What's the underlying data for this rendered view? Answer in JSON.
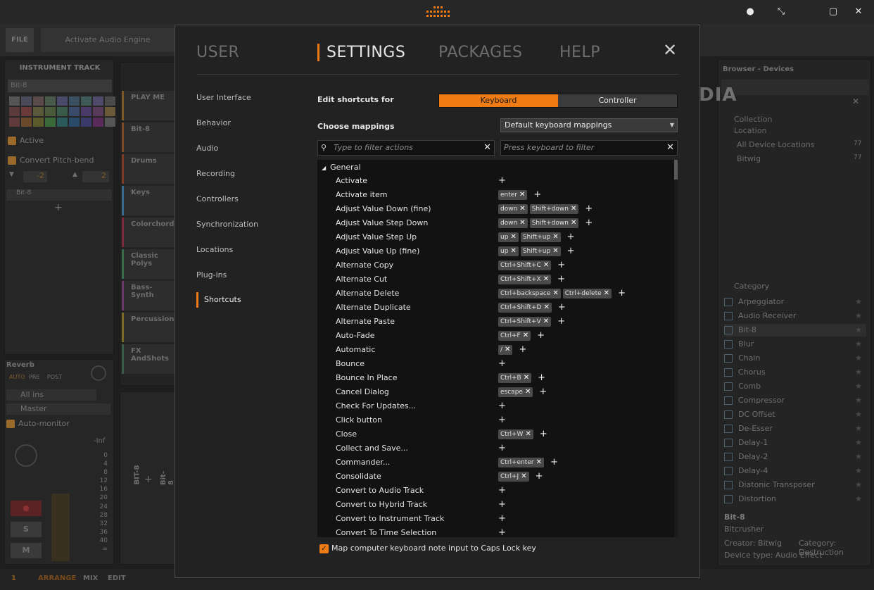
{
  "window": {
    "dot": "●",
    "restore": "⤡",
    "maximize": "▢",
    "close": "✕"
  },
  "toolbar": {
    "file_label": "FILE",
    "activate_label": "Activate Audio Engine"
  },
  "left_panel": {
    "title": "INSTRUMENT TRACK",
    "name_value": "Bit-8",
    "active_label": "Active",
    "pitchbend_label": "Convert Pitch-bend",
    "pb_down": "-2",
    "pb_up": "2",
    "device_label": "Bit-8",
    "add": "+"
  },
  "tracks": [
    "PLAY ME",
    "Bit-8",
    "Drums",
    "Keys",
    "Colorchord",
    "Classic Polys",
    "Bass-Synth",
    "Percussion",
    "FX AndShots"
  ],
  "mixer": {
    "send_label": "Reverb",
    "auto": "AUTO",
    "pre": "PRE",
    "post": "POST",
    "input": "All ins",
    "output": "Master",
    "monitor_label": "Auto-monitor",
    "level": "-Inf",
    "solo": "S",
    "mute": "M",
    "scale": [
      "0",
      "4",
      "8",
      "12",
      "16",
      "20",
      "24",
      "28",
      "32",
      "36",
      "40",
      "∞"
    ],
    "track_name": "BIT-8",
    "track_name2": "Bit-8"
  },
  "bottom": {
    "indicator": "1",
    "arrange": "ARRANGE",
    "mix": "MIX",
    "edit": "EDIT"
  },
  "browser": {
    "title": "Browser - Devices",
    "collection": "Collection",
    "location": "Location",
    "all_locations": "All Device Locations",
    "all_count": "77",
    "bitwig": "Bitwig",
    "bitwig_count": "77",
    "category_title": "Category",
    "categories": [
      "Arpeggiator",
      "Audio Receiver",
      "Bit-8",
      "Blur",
      "Chain",
      "Chorus",
      "Comb",
      "Compressor",
      "DC Offset",
      "De-Esser",
      "Delay-1",
      "Delay-2",
      "Delay-4",
      "Diatonic Transposer",
      "Distortion"
    ],
    "detail_name": "Bit-8",
    "detail_desc": "Bitcrusher",
    "detail_creator": "Creator: Bitwig",
    "detail_category": "Category: Destruction",
    "detail_type": "Device type: Audio Effect"
  },
  "watermark": "SOFTPEDIA",
  "dialog": {
    "tabs": {
      "user": "USER",
      "settings": "SETTINGS",
      "packages": "PACKAGES",
      "help": "HELP"
    },
    "close": "✕",
    "nav": [
      "User Interface",
      "Behavior",
      "Audio",
      "Recording",
      "Controllers",
      "Synchronization",
      "Locations",
      "Plug-ins",
      "Shortcuts"
    ],
    "edit_label": "Edit shortcuts for",
    "keyboard": "Keyboard",
    "controller": "Controller",
    "mappings_label": "Choose mappings",
    "mappings_value": "Default keyboard mappings",
    "filter_actions_placeholder": "Type to filter actions",
    "filter_keys_placeholder": "Press keyboard to filter",
    "group": "General",
    "shortcuts": [
      {
        "name": "Activate",
        "keys": []
      },
      {
        "name": "Activate item",
        "keys": [
          "enter"
        ]
      },
      {
        "name": "Adjust Value Down (fine)",
        "keys": [
          "down",
          "Shift+down"
        ]
      },
      {
        "name": "Adjust Value Step Down",
        "keys": [
          "down",
          "Shift+down"
        ]
      },
      {
        "name": "Adjust Value Step Up",
        "keys": [
          "up",
          "Shift+up"
        ]
      },
      {
        "name": "Adjust Value Up (fine)",
        "keys": [
          "up",
          "Shift+up"
        ]
      },
      {
        "name": "Alternate Copy",
        "keys": [
          "Ctrl+Shift+C"
        ]
      },
      {
        "name": "Alternate Cut",
        "keys": [
          "Ctrl+Shift+X"
        ]
      },
      {
        "name": "Alternate Delete",
        "keys": [
          "Ctrl+backspace",
          "Ctrl+delete"
        ]
      },
      {
        "name": "Alternate Duplicate",
        "keys": [
          "Ctrl+Shift+D"
        ]
      },
      {
        "name": "Alternate Paste",
        "keys": [
          "Ctrl+Shift+V"
        ]
      },
      {
        "name": "Auto-Fade",
        "keys": [
          "Ctrl+F"
        ]
      },
      {
        "name": "Automatic",
        "keys": [
          "/"
        ]
      },
      {
        "name": "Bounce",
        "keys": []
      },
      {
        "name": "Bounce In Place",
        "keys": [
          "Ctrl+B"
        ]
      },
      {
        "name": "Cancel Dialog",
        "keys": [
          "escape"
        ]
      },
      {
        "name": "Check For Updates...",
        "keys": []
      },
      {
        "name": "Click button",
        "keys": []
      },
      {
        "name": "Close",
        "keys": [
          "Ctrl+W"
        ]
      },
      {
        "name": "Collect and Save...",
        "keys": []
      },
      {
        "name": "Commander...",
        "keys": [
          "Ctrl+enter"
        ]
      },
      {
        "name": "Consolidate",
        "keys": [
          "Ctrl+J"
        ]
      },
      {
        "name": "Convert to Audio Track",
        "keys": []
      },
      {
        "name": "Convert to Hybrid Track",
        "keys": []
      },
      {
        "name": "Convert to Instrument Track",
        "keys": []
      },
      {
        "name": "Convert To Time Selection",
        "keys": []
      }
    ],
    "caps_lock_label": "Map computer keyboard note input to Caps Lock key"
  }
}
